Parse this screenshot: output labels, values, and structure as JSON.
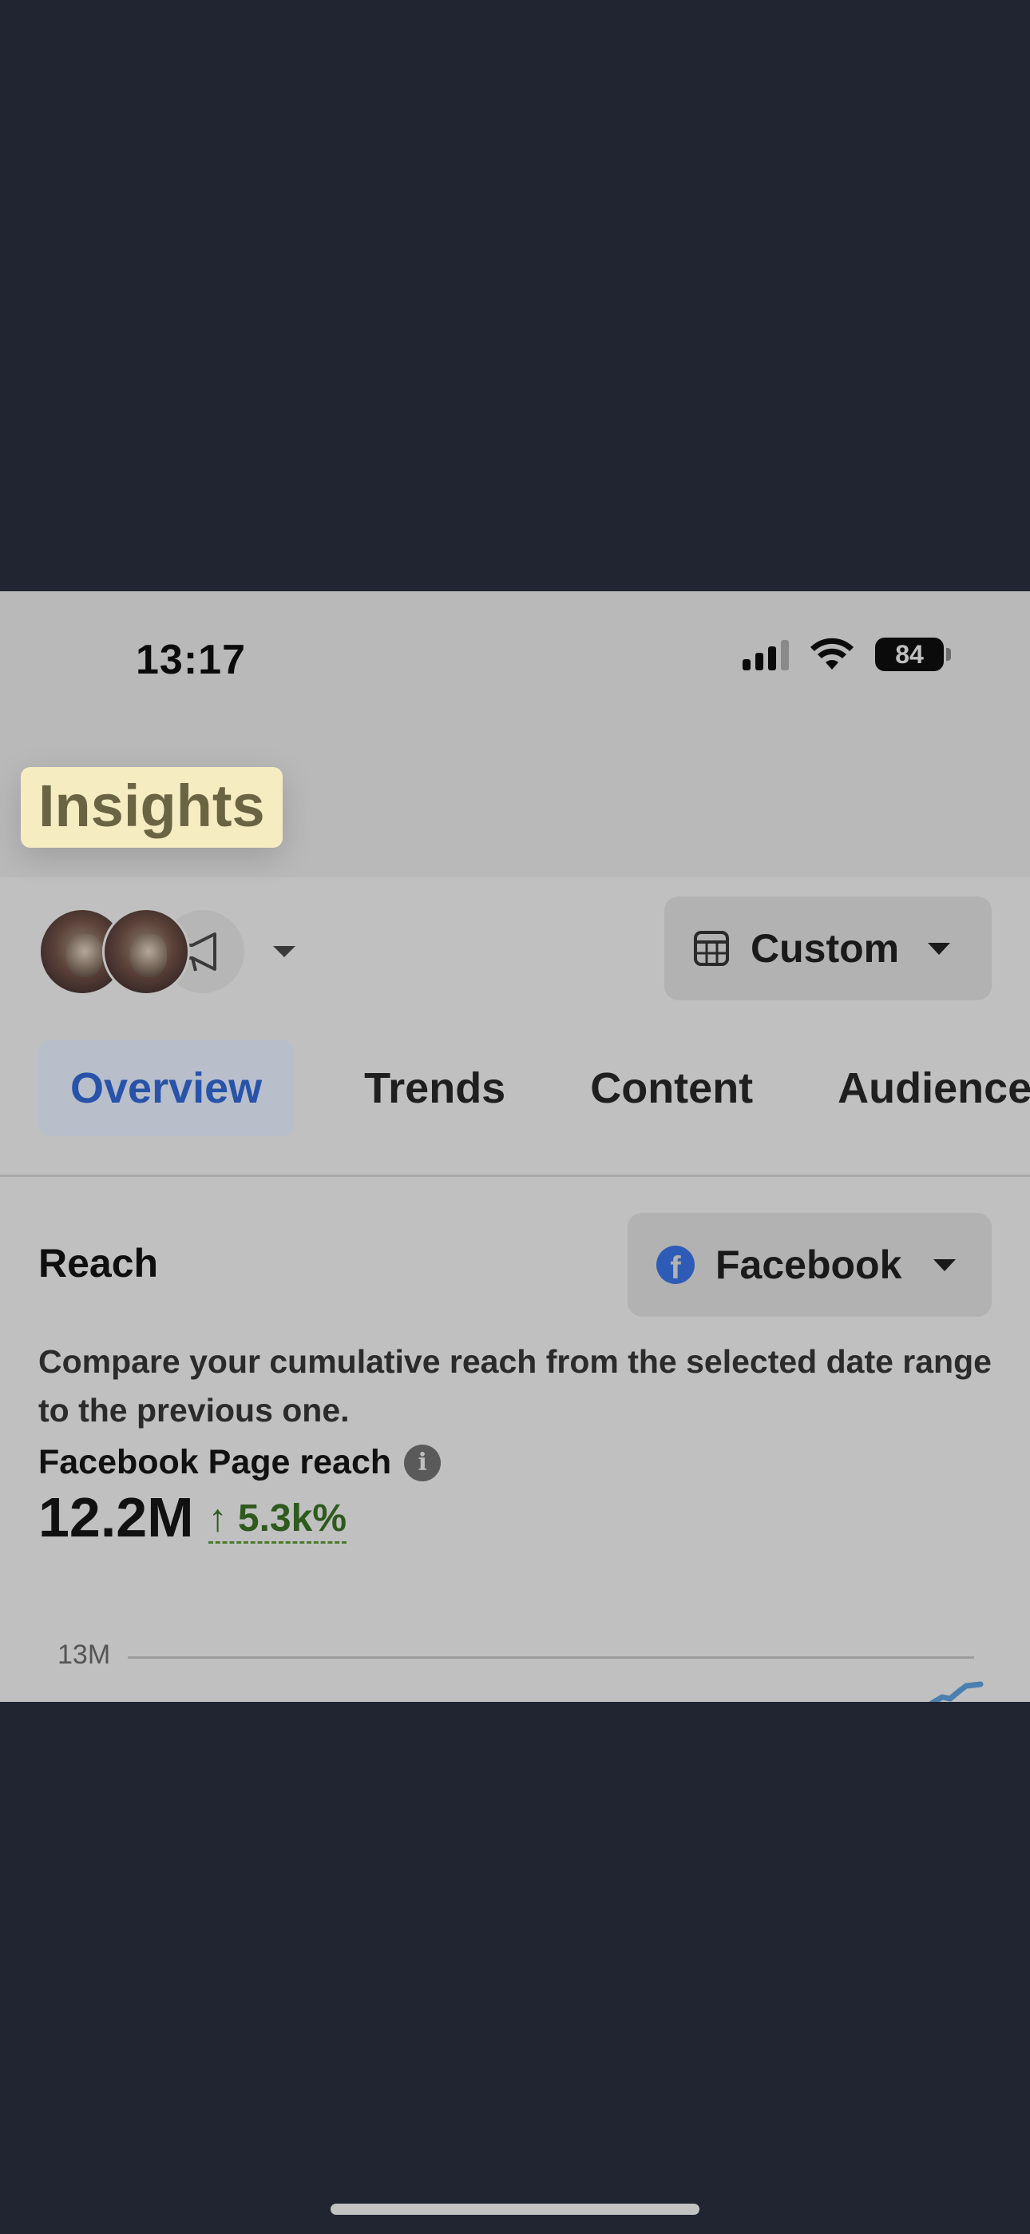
{
  "status_bar": {
    "time": "13:17",
    "battery": "84",
    "icons": [
      "cellular-signal-icon",
      "wifi-icon",
      "battery-icon"
    ]
  },
  "header": {
    "title": "Insights"
  },
  "account_switcher": {
    "icons": [
      "profile-avatar",
      "profile-avatar",
      "megaphone-icon",
      "chevron-down-icon"
    ]
  },
  "date_range": {
    "label": "Custom",
    "icon": "calendar-icon"
  },
  "tabs": [
    {
      "label": "Overview",
      "active": true
    },
    {
      "label": "Trends",
      "active": false
    },
    {
      "label": "Content",
      "active": false
    },
    {
      "label": "Audience",
      "active": false
    }
  ],
  "reach": {
    "title": "Reach",
    "platform": "Facebook",
    "platform_icon": "facebook-icon",
    "description": "Compare your cumulative reach from the selected date range to the previous one.",
    "metric_label": "Facebook Page reach",
    "metric_value": "12.2M",
    "metric_change": "↑ 5.3k%",
    "chart_y_label": "13M"
  },
  "colors": {
    "accent": "#2853a8",
    "positive": "#2e5a1e",
    "highlight": "#f5ecc2",
    "chart_line": "#4a7fb0"
  }
}
